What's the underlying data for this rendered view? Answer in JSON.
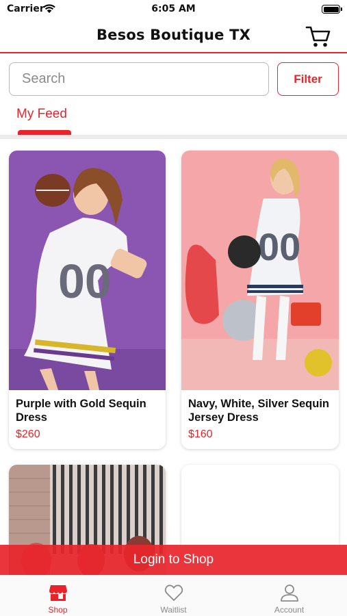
{
  "status_bar": {
    "carrier": "Carrier",
    "time": "6:05 AM"
  },
  "header": {
    "title": "Besos Boutique TX",
    "cart_icon": "cart-icon"
  },
  "search": {
    "placeholder": "Search",
    "value": "",
    "filter_label": "Filter"
  },
  "tabs": [
    {
      "label": "My Feed",
      "active": true
    }
  ],
  "products": [
    {
      "name": "Purple with Gold Sequin Dress",
      "price": "$260",
      "image": "photo of model in white sequin 00 jersey dress on purple backdrop"
    },
    {
      "name": "Navy, White, Silver Sequin Jersey Dress",
      "price": "$160",
      "image": "photo of model in white sequin 00 jersey dress on pink backdrop"
    },
    {
      "name": "",
      "price": "",
      "image": "photo partially visible"
    },
    {
      "name": "",
      "price": "",
      "image": "loading"
    }
  ],
  "banner": {
    "label": "Login to Shop"
  },
  "tab_bar": {
    "items": [
      {
        "label": "Shop",
        "icon": "store-icon",
        "active": true
      },
      {
        "label": "Waitlist",
        "icon": "heart-icon",
        "active": false
      },
      {
        "label": "Account",
        "icon": "person-icon",
        "active": false
      }
    ]
  },
  "colors": {
    "accent": "#e8242a",
    "inactive": "#8a8a8a",
    "text": "#111111"
  }
}
